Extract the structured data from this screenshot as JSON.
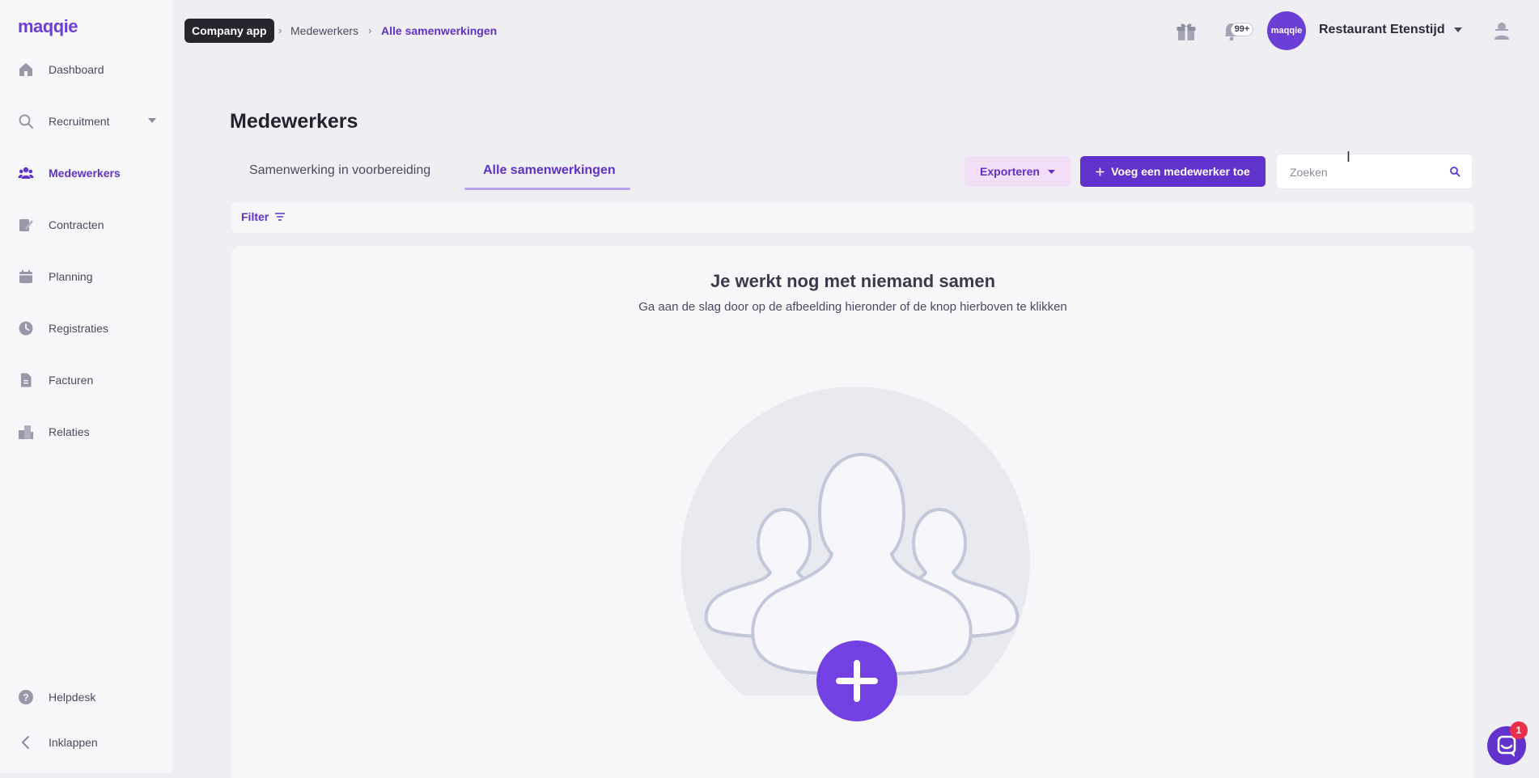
{
  "app": {
    "logo": "maqqie"
  },
  "sidebar": {
    "items": [
      {
        "label": "Dashboard",
        "icon": "home-icon"
      },
      {
        "label": "Recruitment",
        "icon": "search-icon",
        "has_dropdown": true
      },
      {
        "label": "Medewerkers",
        "icon": "users-icon",
        "active": true
      },
      {
        "label": "Contracten",
        "icon": "contract-icon"
      },
      {
        "label": "Planning",
        "icon": "calendar-icon"
      },
      {
        "label": "Registraties",
        "icon": "clock-icon"
      },
      {
        "label": "Facturen",
        "icon": "invoice-icon"
      },
      {
        "label": "Relaties",
        "icon": "buildings-icon"
      }
    ],
    "bottom": [
      {
        "label": "Helpdesk",
        "icon": "help-icon"
      },
      {
        "label": "Inklappen",
        "icon": "chevron-left-icon"
      }
    ]
  },
  "topbar": {
    "breadcrumb": [
      "Company app",
      "Medewerkers",
      "Alle samenwerkingen"
    ],
    "notification_count": "99+",
    "avatar_text": "maqqie",
    "account_name": "Restaurant Etenstijd"
  },
  "page": {
    "title": "Medewerkers",
    "tabs": [
      {
        "label": "Samenwerking in voorbereiding",
        "active": false
      },
      {
        "label": "Alle samenwerkingen",
        "active": true
      }
    ],
    "export_label": "Exporteren",
    "add_label": "Voeg een medewerker toe",
    "search_placeholder": "Zoeken",
    "filter_label": "Filter"
  },
  "empty_state": {
    "title": "Je werkt nog met niemand samen",
    "subtitle": "Ga aan de slag door op de afbeelding hieronder of de knop hierboven te klikken"
  },
  "chat": {
    "unread": "1"
  },
  "colors": {
    "accent": "#6233cc",
    "accent_text": "#5e32c9",
    "export_bg": "#f3def8"
  }
}
